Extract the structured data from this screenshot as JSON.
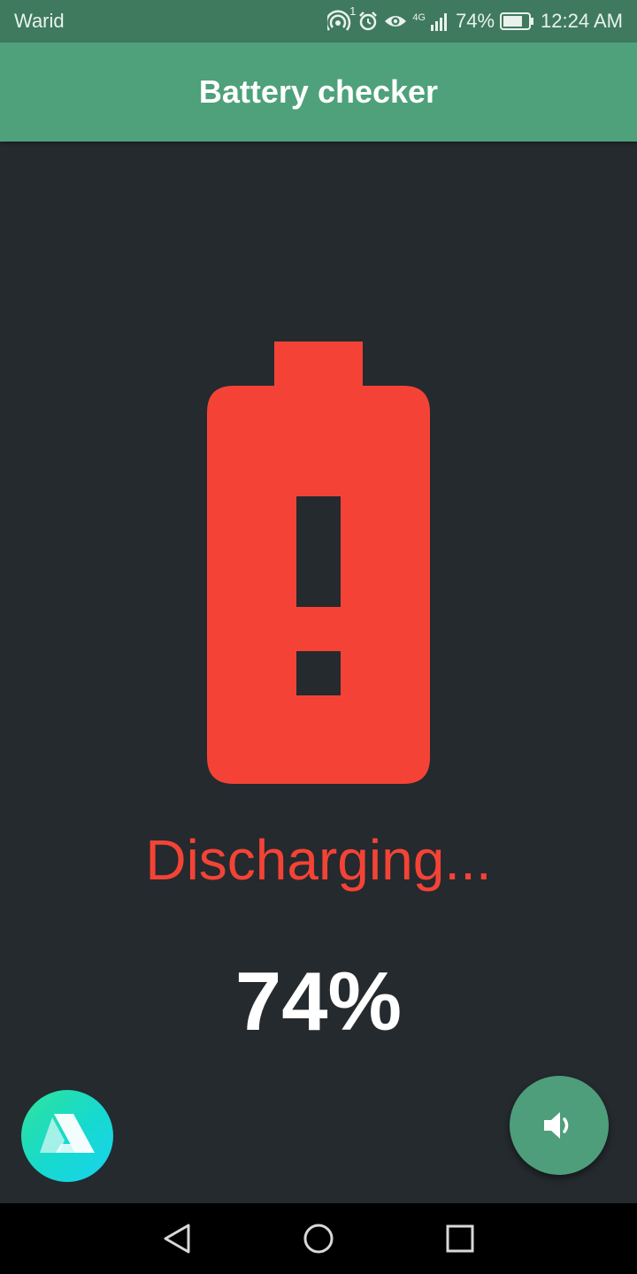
{
  "status_bar": {
    "carrier": "Warid",
    "hotspot_badge": "1",
    "network_type": "4G",
    "battery_percent_label": "74%",
    "time": "12:24 AM",
    "icons": [
      "hotspot-icon",
      "alarm-icon",
      "eye-icon",
      "signal-icon",
      "battery-status-icon"
    ]
  },
  "app_bar": {
    "title": "Battery checker"
  },
  "main": {
    "battery_icon": "battery-alert-icon",
    "status_text": "Discharging...",
    "percent": "74%",
    "colors": {
      "alert": "#f44336",
      "accent": "#4ea17a",
      "background": "#242a2e"
    }
  },
  "buttons": {
    "app_logo": "app-logo-icon",
    "sound": "volume-icon"
  },
  "nav": {
    "icons": [
      "back-icon",
      "home-icon",
      "recents-icon"
    ]
  }
}
